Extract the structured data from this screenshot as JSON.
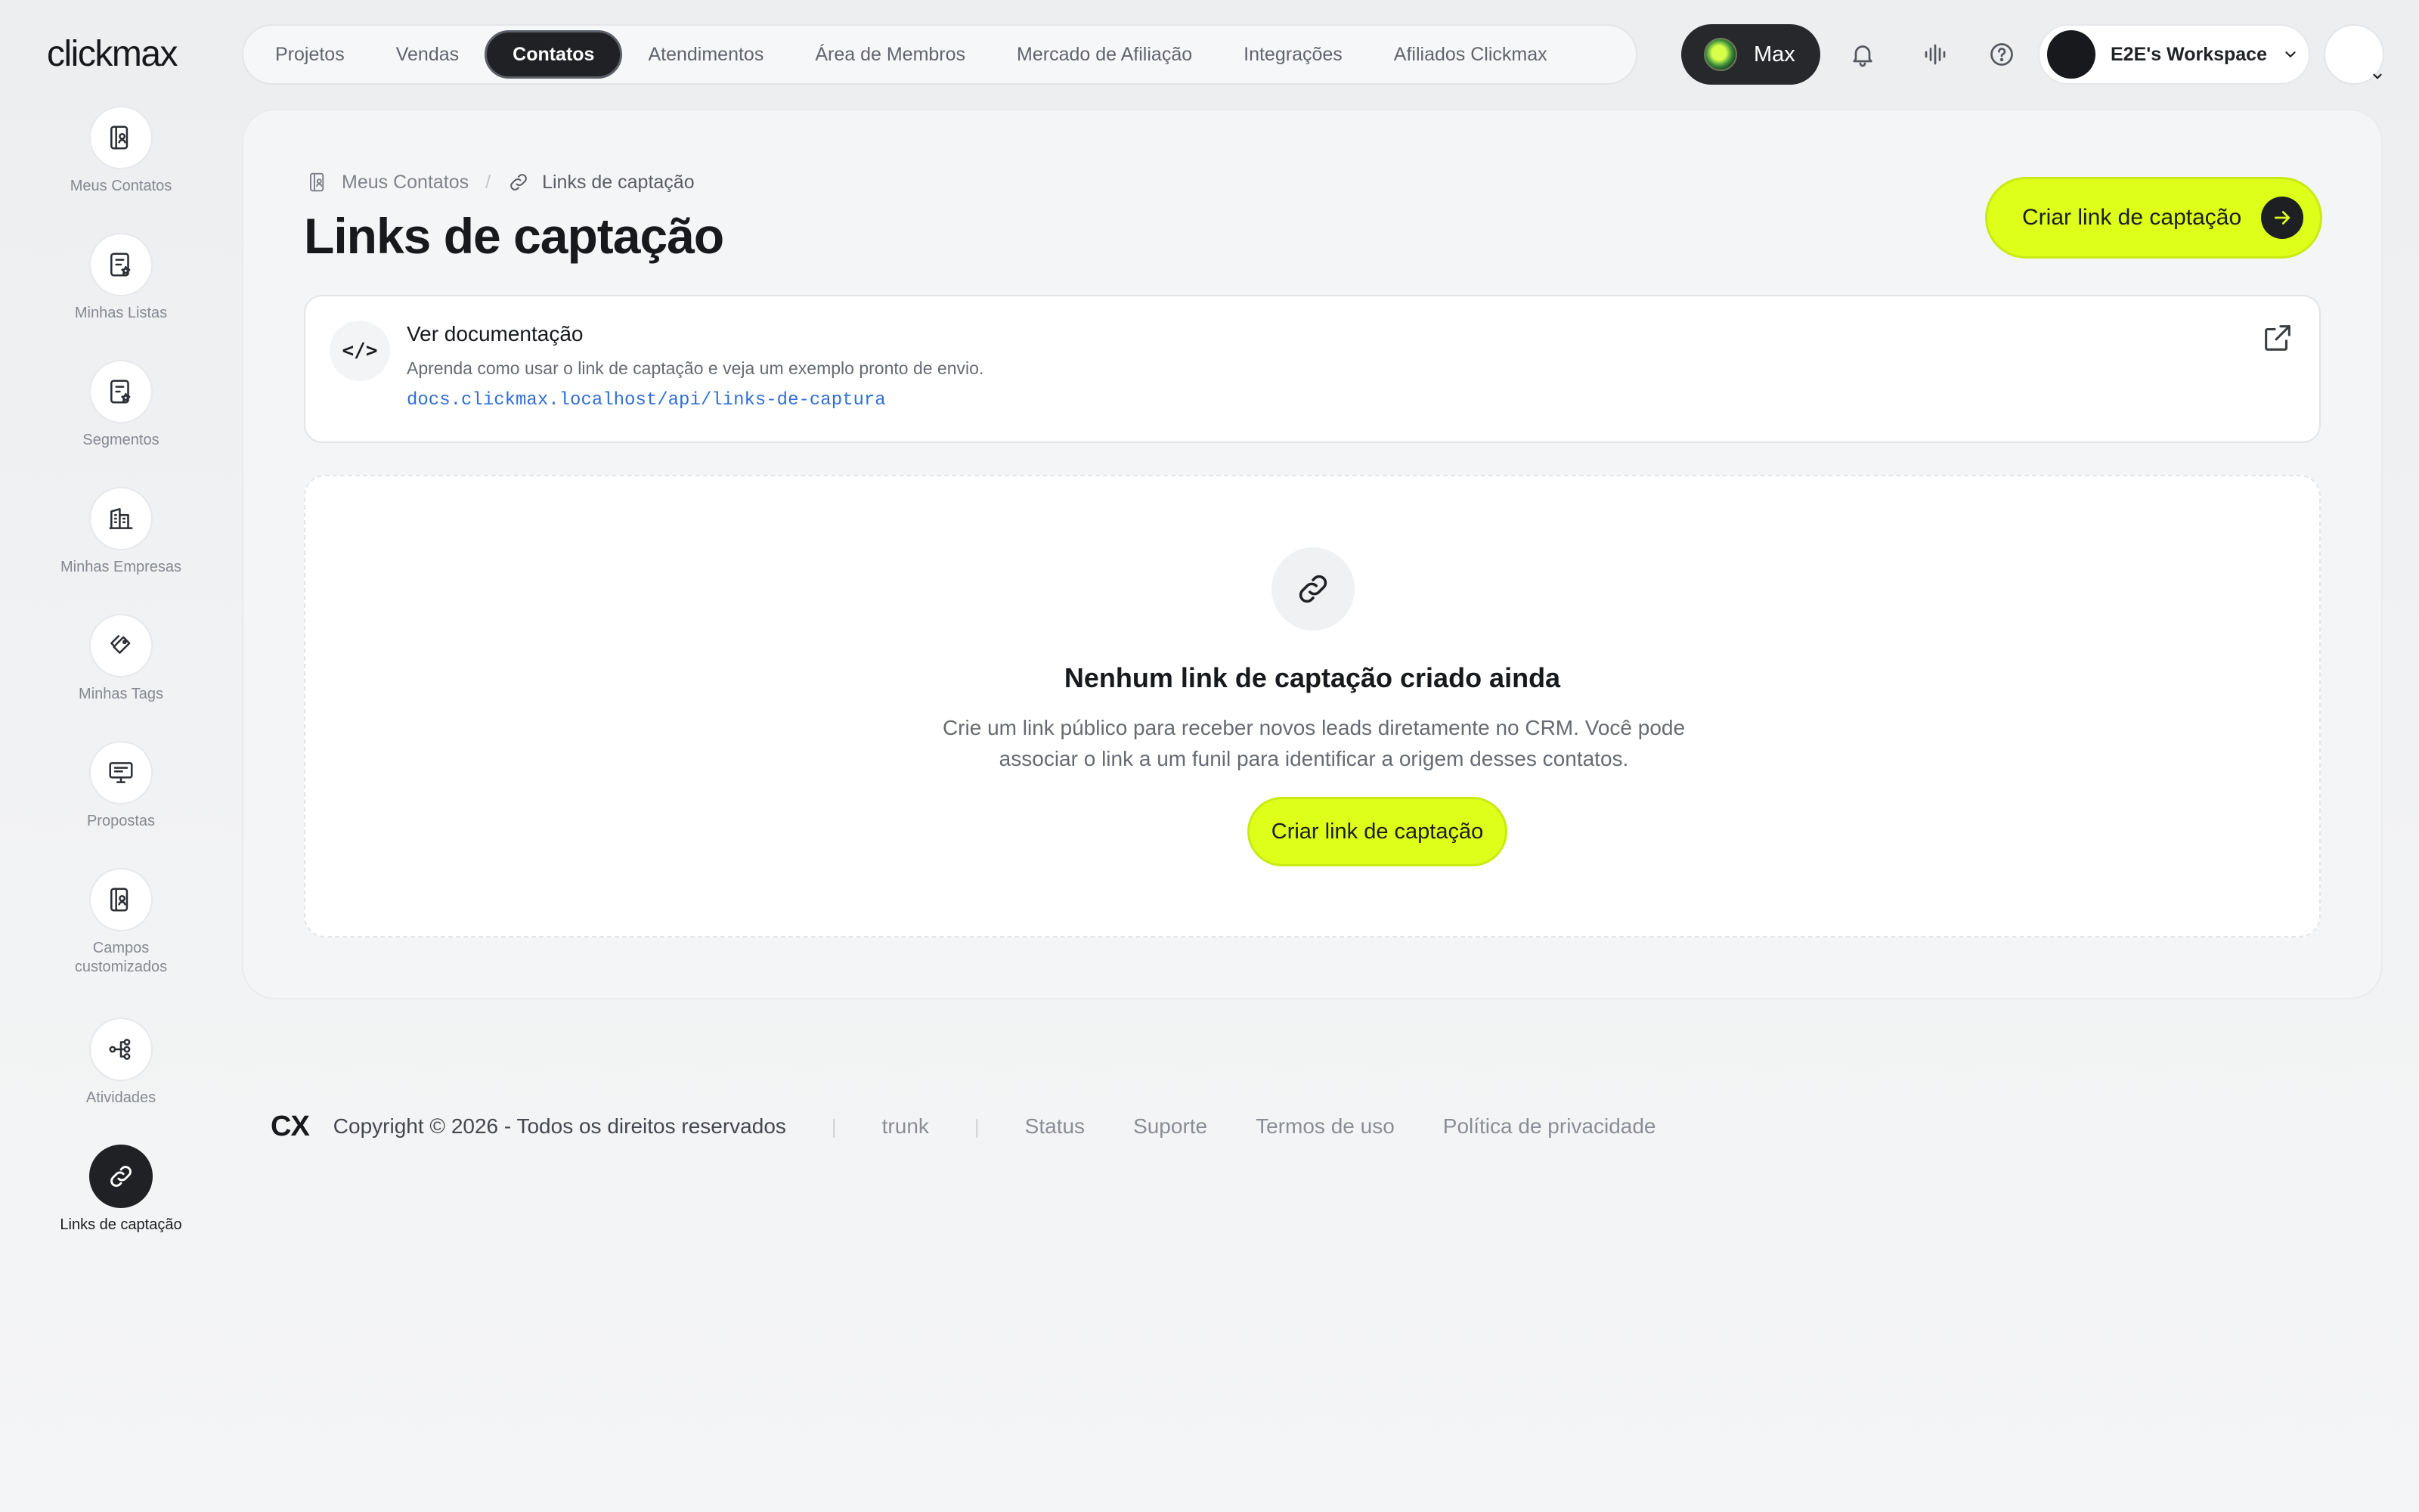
{
  "app": {
    "logo": "clickmax"
  },
  "topnav": {
    "items": [
      {
        "label": "Projetos"
      },
      {
        "label": "Vendas"
      },
      {
        "label": "Contatos",
        "active": true
      },
      {
        "label": "Atendimentos"
      },
      {
        "label": "Área de Membros"
      },
      {
        "label": "Mercado de Afiliação"
      },
      {
        "label": "Integrações"
      },
      {
        "label": "Afiliados Clickmax"
      }
    ],
    "max_label": "Max",
    "workspace_label": "E2E's Workspace",
    "icons": [
      "bell-icon",
      "audio-wave-icon",
      "help-icon",
      "chevron-down-icon"
    ]
  },
  "sidebar": {
    "items": [
      {
        "label": "Meus Contatos",
        "icon": "contacts-book-icon"
      },
      {
        "label": "Minhas Listas",
        "icon": "list-star-icon"
      },
      {
        "label": "Segmentos",
        "icon": "segment-icon"
      },
      {
        "label": "Minhas Empresas",
        "icon": "building-icon"
      },
      {
        "label": "Minhas Tags",
        "icon": "tag-icon"
      },
      {
        "label": "Propostas",
        "icon": "presentation-icon"
      },
      {
        "label": "Campos customizados",
        "icon": "custom-fields-icon"
      },
      {
        "label": "Atividades",
        "icon": "activity-flow-icon"
      },
      {
        "label": "Links de captação",
        "icon": "link-icon",
        "active": true
      }
    ]
  },
  "main": {
    "breadcrumb": {
      "parent": "Meus Contatos",
      "separator": "/",
      "current": "Links de captação"
    },
    "title": "Links de captação",
    "cta_label": "Criar link de captação",
    "doc_card": {
      "title": "Ver documentação",
      "description": "Aprenda como usar o link de captação e veja um exemplo pronto de envio.",
      "url": "docs.clickmax.localhost/api/links-de-captura",
      "icon_text": "</>"
    },
    "empty_state": {
      "title": "Nenhum link de captação criado ainda",
      "description": "Crie um link público para receber novos leads diretamente no CRM. Você pode associar o link a um funil para identificar a origem desses contatos.",
      "cta_label": "Criar link de captação"
    }
  },
  "footer": {
    "logo": "CX",
    "copyright": "Copyright © 2026 - Todos os direitos reservados",
    "version": "trunk",
    "links": [
      "Status",
      "Suporte",
      "Termos de uso",
      "Política de privacidade"
    ]
  },
  "colors": {
    "accent": "#ddff1a",
    "dark": "#1f2124",
    "link": "#2f6fd6"
  }
}
